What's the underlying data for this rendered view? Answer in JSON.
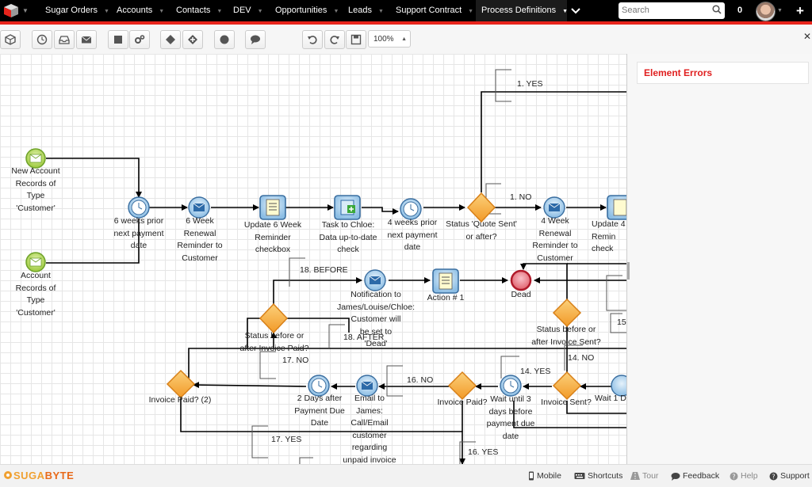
{
  "nav": {
    "items": [
      {
        "label": "Sugar Orders"
      },
      {
        "label": "Accounts"
      },
      {
        "label": "Contacts"
      },
      {
        "label": "DEV"
      },
      {
        "label": "Opportunities"
      },
      {
        "label": "Leads"
      },
      {
        "label": "Support Contract"
      },
      {
        "label": "Process Definitions"
      }
    ],
    "search_placeholder": "Search",
    "notification_count": "0"
  },
  "toolbar": {
    "zoom": "100%"
  },
  "panel": {
    "title": "Element Errors"
  },
  "diagram": {
    "start1": "New Account\nRecords of\nType\n'Customer'",
    "start2": "Account\nRecords of\nType\n'Customer'",
    "timer1": "6 weeks prior\nnext payment\ndate",
    "msg1": "6 Week\nRenewal\nReminder to\nCustomer",
    "task1": "Update 6 Week\nReminder\ncheckbox",
    "task2": "Task to Chloe:\nData up-to-date\ncheck",
    "timer2": "4 weeks prior\nnext payment\ndate",
    "gw1": "Status 'Quote Sent'\nor after?",
    "msg2": "4 Week\nRenewal\nReminder to\nCustomer",
    "task3": "Update 4\nRemin\ncheck",
    "yes1": "1. YES",
    "no1": "1. NO",
    "before18": "18. BEFORE",
    "notify": "Notification to\nJames/Louise/Chloe:\nCustomer will\nbe set to\n'Dead'",
    "action1": "Action # 1",
    "dead": "Dead",
    "gw2": "Status before or\nafter Invoice Paid?",
    "after18": "18. AFTER",
    "gw3": "Status before or\nafter Invoice Sent?",
    "no17": "17. NO",
    "num15": "15",
    "no14": "14. NO",
    "yes14": "14. YES",
    "gwpaid2": "Invoice Paid? (2)",
    "timer3": "2 Days after\nPayment Due\nDate",
    "email": "Email to\nJames:\nCall/Email\ncustomer\nregarding\nunpaid invoice",
    "no16": "16. NO",
    "gwpaid": "Invoice Paid?",
    "wait3": "Wait until 3\ndays before\npayment due\ndate",
    "gwsent": "Invoice Sent?",
    "wait1": "Wait 1 D",
    "yes17": "17. YES",
    "yes16": "16. YES"
  },
  "footer": {
    "brand_a": "SUGA",
    "brand_b": "BYTE",
    "mobile": "Mobile",
    "shortcuts": "Shortcuts",
    "tour": "Tour",
    "feedback": "Feedback",
    "help": "Help",
    "support": "Support"
  }
}
